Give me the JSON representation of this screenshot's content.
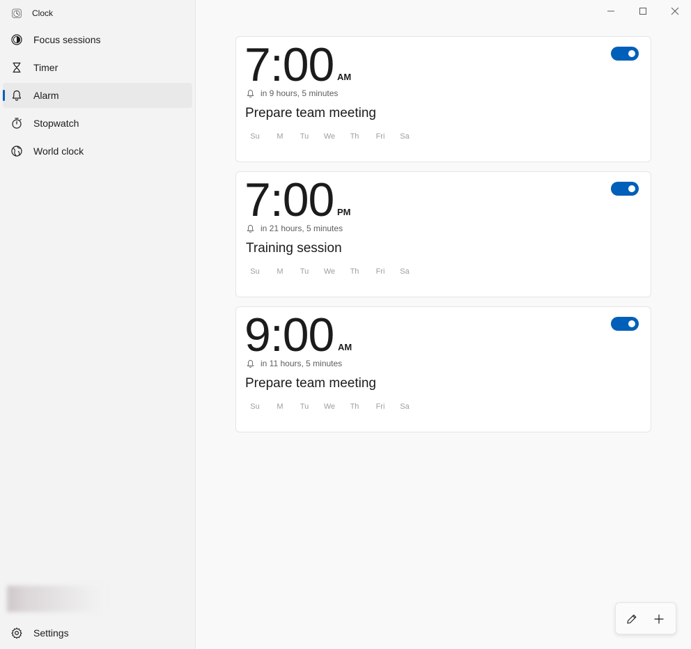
{
  "app": {
    "title": "Clock",
    "accent_color": "#005fb8"
  },
  "sidebar": {
    "items": [
      {
        "label": "Focus sessions",
        "icon": "focus-icon"
      },
      {
        "label": "Timer",
        "icon": "hourglass-icon"
      },
      {
        "label": "Alarm",
        "icon": "bell-icon",
        "selected": true
      },
      {
        "label": "Stopwatch",
        "icon": "stopwatch-icon"
      },
      {
        "label": "World clock",
        "icon": "globe-icon"
      }
    ],
    "settings_label": "Settings"
  },
  "window_controls": [
    "minimize-icon",
    "maximize-icon",
    "close-icon"
  ],
  "alarms": [
    {
      "time": "7:00",
      "period": "AM",
      "remaining": "in 9 hours, 5 minutes",
      "name": "Prepare team meeting",
      "enabled": true
    },
    {
      "time": "7:00",
      "period": "PM",
      "remaining": "in 21 hours, 5 minutes",
      "name": "Training session",
      "enabled": true
    },
    {
      "time": "9:00",
      "period": "AM",
      "remaining": "in 11 hours, 5 minutes",
      "name": "Prepare team meeting",
      "enabled": true
    }
  ],
  "days": [
    "Su",
    "M",
    "Tu",
    "We",
    "Th",
    "Fri",
    "Sa"
  ],
  "command_bar": {
    "edit_icon": "pencil-icon",
    "add_icon": "plus-icon"
  }
}
